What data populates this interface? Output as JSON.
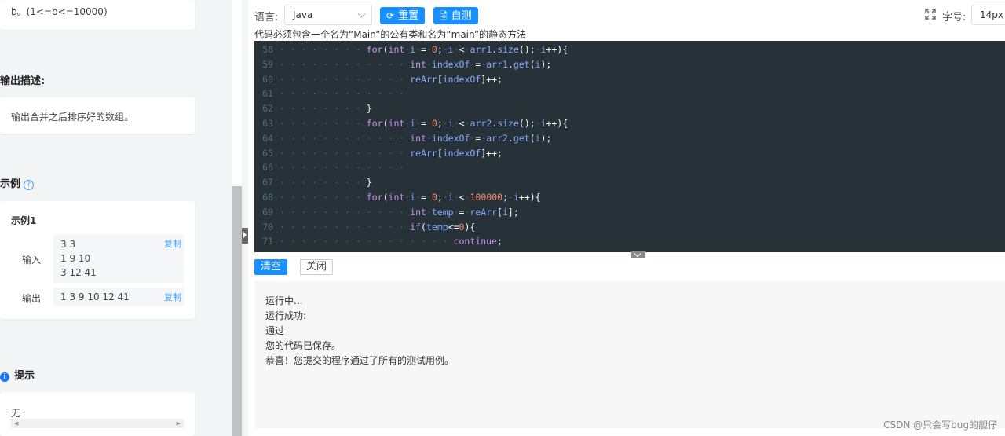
{
  "problem": {
    "input_desc_tail": "b。(1<=b<=10000)",
    "output_title": "输出描述:",
    "output_desc": "输出合并之后排序好的数组。",
    "example_title": "示例",
    "example1_title": "示例1",
    "input_label": "输入",
    "input_lines": [
      "3 3",
      "1 9 10",
      "3 12 41"
    ],
    "output_label": "输出",
    "output_value": "1 3 9 10 12 41",
    "copy_label": "复制",
    "hint_title": "提示",
    "hint_text": "无"
  },
  "toolbar": {
    "language_label": "语言:",
    "language_value": "Java",
    "reset_label": "重置",
    "selftest_label": "自测",
    "fontsize_label": "字号:",
    "fontsize_value": "14px",
    "hint": "代码必须包含一个名为“Main”的公有类和名为“main”的静态方法"
  },
  "code": [
    {
      "n": "58",
      "t": "for(int i = 0; i < arr1.size(); i++){"
    },
    {
      "n": "59",
      "t": "int indexOf = arr1.get(i);"
    },
    {
      "n": "60",
      "t": "reArr[indexOf]++;"
    },
    {
      "n": "61",
      "t": ""
    },
    {
      "n": "62",
      "t": "}"
    },
    {
      "n": "63",
      "t": "for(int i = 0; i < arr2.size(); i++){"
    },
    {
      "n": "64",
      "t": "int indexOf = arr2.get(i);"
    },
    {
      "n": "65",
      "t": "reArr[indexOf]++;"
    },
    {
      "n": "66",
      "t": ""
    },
    {
      "n": "67",
      "t": "}"
    },
    {
      "n": "68",
      "t": "for(int i = 0; i < 100000; i++){"
    },
    {
      "n": "69",
      "t": "int temp = reArr[i];"
    },
    {
      "n": "70",
      "t": "if(temp<=0){"
    },
    {
      "n": "71",
      "t": "continue;"
    }
  ],
  "console": {
    "clear_label": "清空",
    "close_label": "关闭",
    "lines": [
      "运行中...",
      "运行成功:",
      "通过",
      "您的代码已保存。",
      "恭喜！您提交的程序通过了所有的测试用例。"
    ]
  },
  "watermark": "CSDN @只会写bug的靓仔"
}
